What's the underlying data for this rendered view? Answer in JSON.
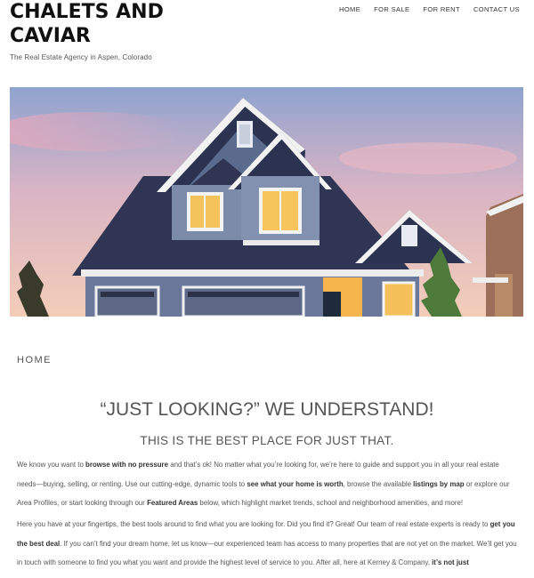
{
  "header": {
    "site_title": "CHALETS AND CAVIAR",
    "tagline": "The Real Estate Agency in Aspen, Colorado"
  },
  "nav": {
    "items": [
      {
        "label": "HOME"
      },
      {
        "label": "FOR SALE"
      },
      {
        "label": "FOR RENT"
      },
      {
        "label": "CONTACT US"
      }
    ]
  },
  "breadcrumb": "HOME",
  "content": {
    "headline": "“JUST LOOKING?” WE UNDERSTAND!",
    "subheadline": "THIS IS THE BEST PLACE FOR JUST THAT.",
    "p1": {
      "a": "We know you want to ",
      "b": "browse with no pressure",
      "c": " and that’s ok! No matter what you’re looking for, we’re here to guide and support you in all your real estate needs—buying, selling, or renting. Use our cutting-edge, dynamic tools to ",
      "d": "see what your home is worth",
      "e": ", browse the available ",
      "f": "listings by map",
      "g": " or explore our Area Profiles, or start looking through our ",
      "h": "Featured Areas",
      "i": " below, which highlight market trends, school and neighborhood amenities, and more!"
    },
    "p2": {
      "a": "Here you have at your fingertips, the best tools around to find what you are looking for. Did you find it? Great! Our team of real estate experts is ready to ",
      "b": "get you the best deal",
      "c": ". If you can’t find your dream home, let us know—our experienced team has access to many properties that are not yet on the market. We’ll get you in touch with someone to find you what you want and provide the highest level of service to you. After all, here at Kerney & Company, ",
      "d": "it’s not just"
    }
  },
  "colors": {
    "sky_top": "#9fb0d4",
    "sky_bottom": "#f2c7b8",
    "roof": "#2e3552",
    "window_light": "#f6c45a",
    "text": "#555555"
  }
}
